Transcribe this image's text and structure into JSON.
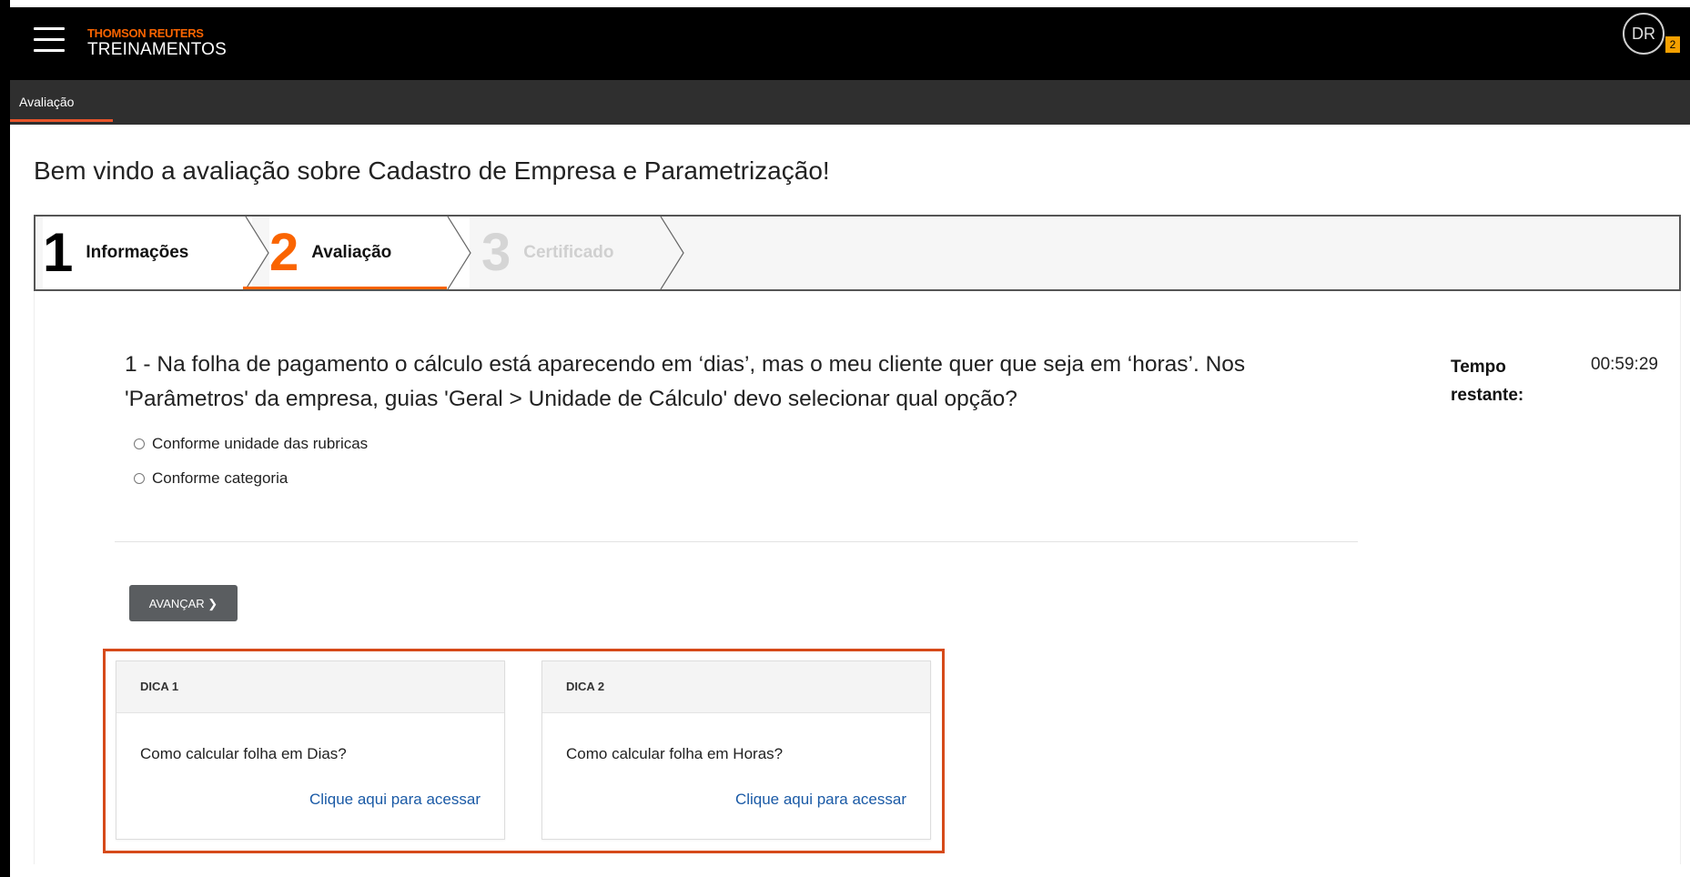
{
  "header": {
    "brand_top": "THOMSON REUTERS",
    "brand_bottom": "TREINAMENTOS",
    "avatar_initials": "DR",
    "avatar_badge": "2",
    "icons": {
      "menu": "hamburger-menu-icon"
    }
  },
  "subnav": {
    "tab_label": "Avaliação"
  },
  "page": {
    "title": "Bem vindo a avaliação sobre Cadastro de Empresa e Parametrização!"
  },
  "steps": [
    {
      "number": "1",
      "label": "Informações",
      "state": "done"
    },
    {
      "number": "2",
      "label": "Avaliação",
      "state": "active"
    },
    {
      "number": "3",
      "label": "Certificado",
      "state": "disabled"
    }
  ],
  "question": {
    "text": "1 - Na folha de pagamento o cálculo está aparecendo em ‘dias’, mas o meu cliente quer que seja em ‘horas’. Nos 'Parâmetros' da empresa, guias 'Geral > Unidade de Cálculo' devo selecionar qual opção?",
    "options": [
      "Conforme unidade das rubricas",
      "Conforme categoria"
    ]
  },
  "timer": {
    "label": "Tempo restante:",
    "value": "00:59:29"
  },
  "actions": {
    "next_label": "AVANÇAR ❯"
  },
  "hints": [
    {
      "title": "DICA 1",
      "question": "Como calcular folha em Dias?",
      "link": "Clique aqui para acessar"
    },
    {
      "title": "DICA 2",
      "question": "Como calcular folha em Horas?",
      "link": "Clique aqui para acessar"
    }
  ],
  "colors": {
    "accent": "#fa6400",
    "header_bg": "#000000",
    "subnav_bg": "#2f2f2f",
    "highlight_outline": "#d64a1a",
    "link": "#1a5aa6",
    "button_bg": "#5a5d60"
  }
}
